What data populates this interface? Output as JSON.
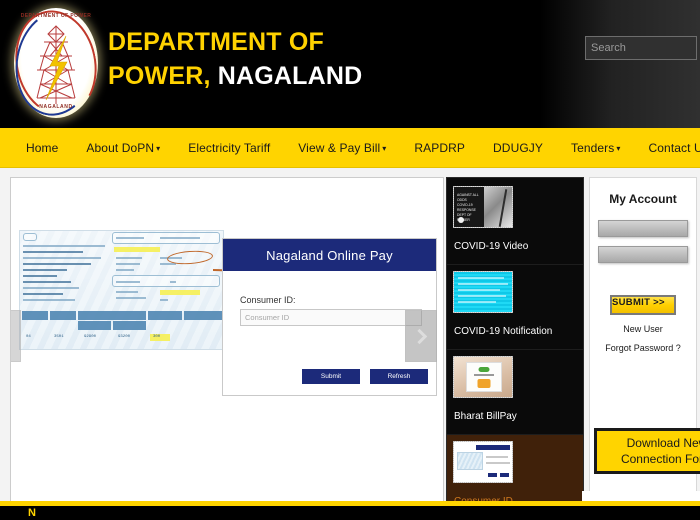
{
  "header": {
    "logo": {
      "name": "department-of-power-nagaland-emblem",
      "arc_text": "DEPARTMENT OF POWER",
      "bottom_text": "NAGALAND"
    },
    "title_line1": "DEPARTMENT OF",
    "title_line2_yellow": "POWER,",
    "title_line2_white": "NAGALAND",
    "search": {
      "placeholder": "Search",
      "value": ""
    },
    "colors": {
      "background": "#000000",
      "title_yellow": "#FFD200",
      "title_white": "#FFFFFF"
    }
  },
  "nav": {
    "background": "#FFD400",
    "items": [
      {
        "label": "Home",
        "caret": "",
        "has_dropdown": false
      },
      {
        "label": "About DoPN",
        "caret": "▾",
        "has_dropdown": true
      },
      {
        "label": "Electricity Tariff",
        "caret": "",
        "has_dropdown": false
      },
      {
        "label": "View & Pay Bill",
        "caret": "▾",
        "has_dropdown": true
      },
      {
        "label": "RAPDRP",
        "caret": "",
        "has_dropdown": false
      },
      {
        "label": "DDUGJY",
        "caret": "",
        "has_dropdown": false
      },
      {
        "label": "Tenders",
        "caret": "▾",
        "has_dropdown": true
      },
      {
        "label": "Contact Us",
        "caret": "",
        "has_dropdown": false
      }
    ]
  },
  "slider": {
    "prev_arrow": "‹",
    "next_arrow": "›",
    "bill_image": {
      "name": "sample-electricity-bill",
      "fields": [
        {
          "label": "Sub Division",
          "value": "DIMAPUR SUB 1"
        },
        {
          "label": "Electricity Bill for",
          "value": ""
        },
        {
          "label": "Consumer No",
          "value": ""
        },
        {
          "label": "Reading Date",
          "value": ""
        },
        {
          "label": "Bill Date",
          "value": ""
        },
        {
          "label": "Supply at",
          "value": ""
        },
        {
          "label": "Category",
          "value": "Domestic power"
        },
        {
          "label": "Consumer Class",
          "value": "LT"
        }
      ],
      "address_lines": [
        "CIRCULAR ROAD",
        "DIMAPUR NAGALAND",
        "Dimapur",
        "797112",
        "Mobile No:"
      ],
      "table_headers": [
        "BILLING CYCLE",
        "METER NUMBER",
        "METER READING PREVIOUS",
        "METER READING PRESENT",
        "UNITS CONSUMED",
        "AMOUNT"
      ],
      "table_row": [
        "04",
        "3501",
        "92900",
        "93200",
        "300",
        ""
      ],
      "highlight_color": "#F6EF5C",
      "circle_color": "#C0682B"
    },
    "card": {
      "title": "Nagaland Online Pay",
      "field_label": "Consumer ID:",
      "input_placeholder": "Consumer ID",
      "input_value": "",
      "submit_label": "Submit",
      "refresh_label": "Refresh",
      "header_color": "#1C2A7A"
    }
  },
  "thumbnails": {
    "items": [
      {
        "label": "COVID-19 Video",
        "icon": "covid-video-thumbnail",
        "active": false
      },
      {
        "label": "COVID-19 Notification",
        "icon": "covid-notification-thumbnail",
        "active": false
      },
      {
        "label": "Bharat BillPay",
        "icon": "bharat-billpay-thumbnail",
        "active": false
      },
      {
        "label": "Consumer ID",
        "icon": "consumer-id-thumbnail",
        "active": true
      }
    ],
    "active_background": "#40210A",
    "active_text_color": "#D07A1F"
  },
  "sidebar": {
    "title": "My Account",
    "username": {
      "value": "",
      "placeholder": ""
    },
    "password": {
      "value": "",
      "placeholder": ""
    },
    "submit_label": "SUBMIT >>",
    "new_user_label": "New User",
    "forgot_password_label": "Forgot Password ?",
    "download_button_label": "Download New Connection Form",
    "accent": "#FFD400"
  },
  "footer": {
    "strip_color": "#FFD400",
    "background": "#000000",
    "glyph": "N"
  }
}
